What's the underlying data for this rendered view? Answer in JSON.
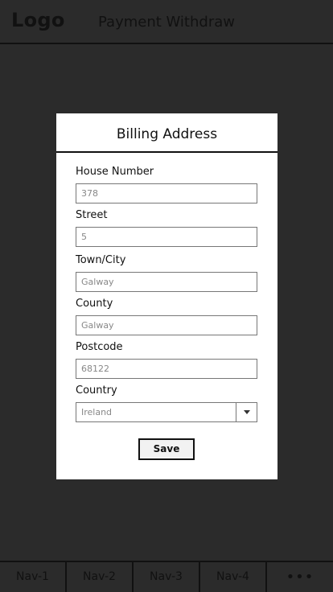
{
  "header": {
    "logo": "Logo",
    "title": "Payment Withdraw"
  },
  "modal": {
    "title": "Billing Address",
    "fields": {
      "house_number": {
        "label": "House Number",
        "value": "378"
      },
      "street": {
        "label": "Street",
        "value": "5"
      },
      "town": {
        "label": "Town/City",
        "value": "Galway"
      },
      "county": {
        "label": "County",
        "value": "Galway"
      },
      "postcode": {
        "label": "Postcode",
        "value": "68122"
      },
      "country": {
        "label": "Country",
        "value": "Ireland"
      }
    },
    "save_label": "Save"
  },
  "nav": {
    "items": [
      "Nav-1",
      "Nav-2",
      "Nav-3",
      "Nav-4"
    ],
    "more": "•••"
  },
  "colors": {
    "overlay": "#2b2b2b",
    "modal_bg": "#ffffff",
    "border": "#111111"
  }
}
